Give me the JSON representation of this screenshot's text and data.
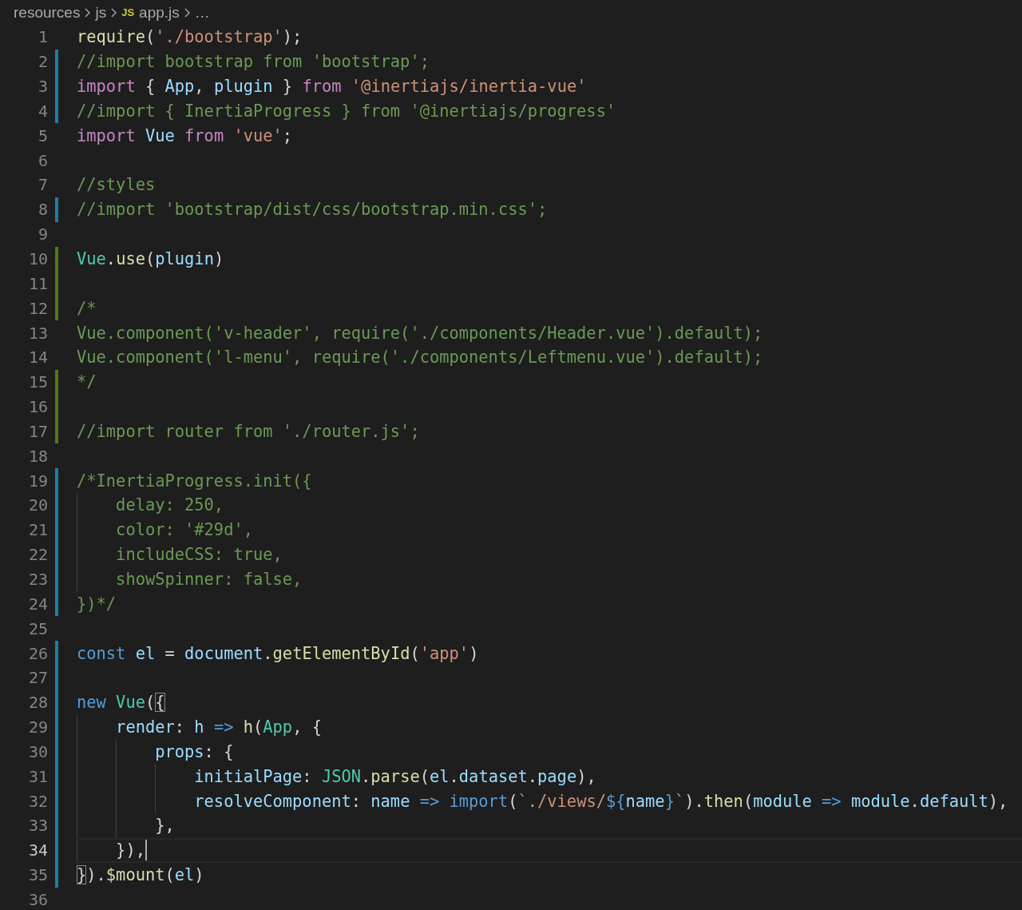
{
  "breadcrumb": [
    {
      "text": "resources"
    },
    {
      "text": "js"
    },
    {
      "text": "app.js",
      "badge": "JS"
    },
    {
      "text": "…"
    }
  ],
  "editor": {
    "lines": [
      {
        "number": "1",
        "modified": false,
        "added": false,
        "current": false,
        "tokens": [
          {
            "kind": "fn",
            "text": "require"
          },
          {
            "kind": "plain",
            "text": "("
          },
          {
            "kind": "str",
            "text": "'./bootstrap'"
          },
          {
            "kind": "plain",
            "text": ");"
          }
        ]
      },
      {
        "number": "2",
        "modified": true,
        "added": false,
        "current": false,
        "tokens": [
          {
            "kind": "com",
            "text": "//import bootstrap from 'bootstrap';"
          }
        ]
      },
      {
        "number": "3",
        "modified": true,
        "added": false,
        "current": false,
        "tokens": [
          {
            "kind": "kw",
            "text": "import"
          },
          {
            "kind": "plain",
            "text": " { "
          },
          {
            "kind": "var",
            "text": "App"
          },
          {
            "kind": "plain",
            "text": ", "
          },
          {
            "kind": "var",
            "text": "plugin"
          },
          {
            "kind": "plain",
            "text": " } "
          },
          {
            "kind": "kw",
            "text": "from "
          },
          {
            "kind": "str",
            "text": "'@inertiajs/inertia-vue'"
          }
        ]
      },
      {
        "number": "4",
        "modified": true,
        "added": false,
        "current": false,
        "tokens": [
          {
            "kind": "com",
            "text": "//import { InertiaProgress } from '@inertiajs/progress'"
          }
        ]
      },
      {
        "number": "5",
        "modified": false,
        "added": false,
        "current": false,
        "tokens": [
          {
            "kind": "kw",
            "text": "import "
          },
          {
            "kind": "var",
            "text": "Vue "
          },
          {
            "kind": "kw",
            "text": "from "
          },
          {
            "kind": "str",
            "text": "'vue'"
          },
          {
            "kind": "plain",
            "text": ";"
          }
        ]
      },
      {
        "number": "6",
        "modified": false,
        "added": false,
        "current": false
      },
      {
        "number": "7",
        "modified": false,
        "added": false,
        "current": false,
        "tokens": [
          {
            "kind": "com",
            "text": "//styles"
          }
        ]
      },
      {
        "number": "8",
        "modified": true,
        "added": false,
        "current": false,
        "tokens": [
          {
            "kind": "com",
            "text": "//import 'bootstrap/dist/css/bootstrap.min.css';"
          }
        ]
      },
      {
        "number": "9",
        "modified": false,
        "added": false,
        "current": false
      },
      {
        "number": "10",
        "modified": false,
        "added": true,
        "current": false,
        "tokens": [
          {
            "kind": "type",
            "text": "Vue"
          },
          {
            "kind": "plain",
            "text": "."
          },
          {
            "kind": "fn",
            "text": "use"
          },
          {
            "kind": "plain",
            "text": "("
          },
          {
            "kind": "var",
            "text": "plugin"
          },
          {
            "kind": "plain",
            "text": ")"
          }
        ]
      },
      {
        "number": "11",
        "modified": false,
        "added": true,
        "current": false
      },
      {
        "number": "12",
        "modified": false,
        "added": true,
        "current": false,
        "tokens": [
          {
            "kind": "com",
            "text": "/*"
          }
        ]
      },
      {
        "number": "13",
        "modified": false,
        "added": false,
        "current": false,
        "tokens": [
          {
            "kind": "com",
            "text": "Vue.component('v-header', require('./components/Header.vue').default);"
          }
        ]
      },
      {
        "number": "14",
        "modified": false,
        "added": false,
        "current": false,
        "tokens": [
          {
            "kind": "com",
            "text": "Vue.component('l-menu', require('./components/Leftmenu.vue').default);"
          }
        ]
      },
      {
        "number": "15",
        "modified": false,
        "added": true,
        "current": false,
        "tokens": [
          {
            "kind": "com",
            "text": "*/"
          }
        ]
      },
      {
        "number": "16",
        "modified": false,
        "added": true,
        "current": false
      },
      {
        "number": "17",
        "modified": false,
        "added": true,
        "current": false,
        "tokens": [
          {
            "kind": "com",
            "text": "//import router from './router.js';"
          }
        ]
      },
      {
        "number": "18",
        "modified": false,
        "added": false,
        "current": false
      },
      {
        "number": "19",
        "modified": true,
        "added": false,
        "current": false,
        "tokens": [
          {
            "kind": "com",
            "text": "/*InertiaProgress.init({"
          }
        ]
      },
      {
        "number": "20",
        "modified": true,
        "added": false,
        "current": false,
        "tokens": [
          {
            "kind": "com",
            "text": "    delay: 250,"
          }
        ]
      },
      {
        "number": "21",
        "modified": true,
        "added": false,
        "current": false,
        "tokens": [
          {
            "kind": "com",
            "text": "    color: '#29d',"
          }
        ]
      },
      {
        "number": "22",
        "modified": true,
        "added": false,
        "current": false,
        "tokens": [
          {
            "kind": "com",
            "text": "    includeCSS: true,"
          }
        ]
      },
      {
        "number": "23",
        "modified": true,
        "added": false,
        "current": false,
        "tokens": [
          {
            "kind": "com",
            "text": "    showSpinner: false,"
          }
        ]
      },
      {
        "number": "24",
        "modified": true,
        "added": false,
        "current": false,
        "tokens": [
          {
            "kind": "com",
            "text": "})*/"
          }
        ]
      },
      {
        "number": "25",
        "modified": false,
        "added": false,
        "current": false
      },
      {
        "number": "26",
        "modified": true,
        "added": false,
        "current": false,
        "tokens": [
          {
            "kind": "storage",
            "text": "const "
          },
          {
            "kind": "var",
            "text": "el"
          },
          {
            "kind": "plain",
            "text": " = "
          },
          {
            "kind": "var",
            "text": "document"
          },
          {
            "kind": "plain",
            "text": "."
          },
          {
            "kind": "fn",
            "text": "getElementById"
          },
          {
            "kind": "plain",
            "text": "("
          },
          {
            "kind": "str",
            "text": "'app'"
          },
          {
            "kind": "plain",
            "text": ")"
          }
        ]
      },
      {
        "number": "27",
        "modified": true,
        "added": false,
        "current": false
      },
      {
        "number": "28",
        "modified": true,
        "added": false,
        "current": false,
        "tokens": [
          {
            "kind": "storage",
            "text": "new "
          },
          {
            "kind": "type",
            "text": "Vue"
          },
          {
            "kind": "plain",
            "text": "("
          },
          {
            "kind": "bracket",
            "text": "{"
          }
        ]
      },
      {
        "number": "29",
        "modified": true,
        "added": false,
        "current": false,
        "tokens": [
          {
            "kind": "var",
            "text": "    render"
          },
          {
            "kind": "plain",
            "text": ": "
          },
          {
            "kind": "var",
            "text": "h "
          },
          {
            "kind": "storage",
            "text": "=> "
          },
          {
            "kind": "fn",
            "text": "h"
          },
          {
            "kind": "plain",
            "text": "("
          },
          {
            "kind": "type",
            "text": "App"
          },
          {
            "kind": "plain",
            "text": ", {"
          }
        ]
      },
      {
        "number": "30",
        "modified": true,
        "added": false,
        "current": false,
        "tokens": [
          {
            "kind": "var",
            "text": "        props"
          },
          {
            "kind": "plain",
            "text": ": {"
          }
        ]
      },
      {
        "number": "31",
        "modified": true,
        "added": false,
        "current": false,
        "tokens": [
          {
            "kind": "var",
            "text": "            initialPage"
          },
          {
            "kind": "plain",
            "text": ": "
          },
          {
            "kind": "type",
            "text": "JSON"
          },
          {
            "kind": "plain",
            "text": "."
          },
          {
            "kind": "fn",
            "text": "parse"
          },
          {
            "kind": "plain",
            "text": "("
          },
          {
            "kind": "var",
            "text": "el"
          },
          {
            "kind": "plain",
            "text": "."
          },
          {
            "kind": "var",
            "text": "dataset"
          },
          {
            "kind": "plain",
            "text": "."
          },
          {
            "kind": "var",
            "text": "page"
          },
          {
            "kind": "plain",
            "text": "),"
          }
        ]
      },
      {
        "number": "32",
        "modified": true,
        "added": false,
        "current": false,
        "tokens": [
          {
            "kind": "var",
            "text": "            resolveComponent"
          },
          {
            "kind": "plain",
            "text": ": "
          },
          {
            "kind": "var",
            "text": "name "
          },
          {
            "kind": "storage",
            "text": "=> import"
          },
          {
            "kind": "plain",
            "text": "("
          },
          {
            "kind": "str",
            "text": "`./views/"
          },
          {
            "kind": "storage",
            "text": "${"
          },
          {
            "kind": "var",
            "text": "name"
          },
          {
            "kind": "storage",
            "text": "}"
          },
          {
            "kind": "str",
            "text": "`"
          },
          {
            "kind": "plain",
            "text": ")."
          },
          {
            "kind": "fn",
            "text": "then"
          },
          {
            "kind": "plain",
            "text": "("
          },
          {
            "kind": "var",
            "text": "module "
          },
          {
            "kind": "storage",
            "text": "=> "
          },
          {
            "kind": "var",
            "text": "module"
          },
          {
            "kind": "plain",
            "text": "."
          },
          {
            "kind": "var",
            "text": "default"
          },
          {
            "kind": "plain",
            "text": "),"
          }
        ]
      },
      {
        "number": "33",
        "modified": true,
        "added": false,
        "current": false,
        "tokens": [
          {
            "kind": "plain",
            "text": "        },"
          }
        ]
      },
      {
        "number": "34",
        "modified": true,
        "added": false,
        "current": true,
        "tokens": [
          {
            "kind": "plain",
            "text": "    }),"
          }
        ]
      },
      {
        "number": "35",
        "modified": true,
        "added": false,
        "current": false,
        "tokens": [
          {
            "kind": "bracket",
            "text": "}"
          },
          {
            "kind": "plain",
            "text": ")."
          },
          {
            "kind": "fn",
            "text": "$mount"
          },
          {
            "kind": "plain",
            "text": "("
          },
          {
            "kind": "var",
            "text": "el"
          },
          {
            "kind": "plain",
            "text": ")"
          }
        ]
      },
      {
        "number": "36",
        "modified": false,
        "added": false,
        "current": false
      }
    ]
  }
}
